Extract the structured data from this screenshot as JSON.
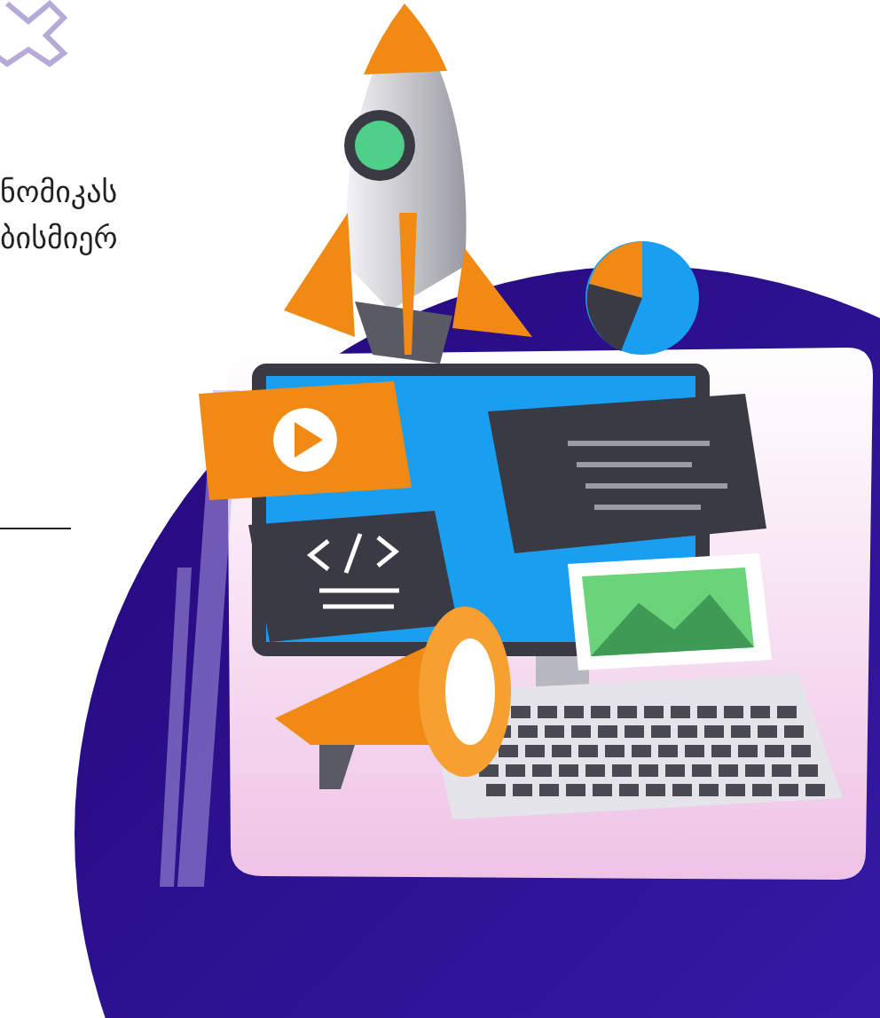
{
  "paragraph": {
    "lines": [
      "ნომიკას",
      "ბისმიერ"
    ]
  }
}
